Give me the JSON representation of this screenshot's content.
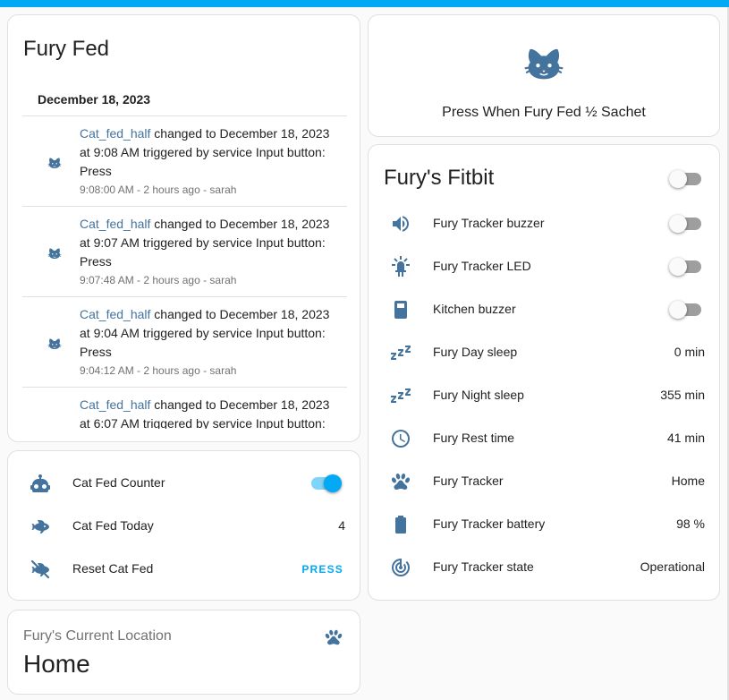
{
  "colors": {
    "accent": "#03a9f4",
    "icon": "#44739e",
    "secondary_text": "#727272"
  },
  "logbook": {
    "title": "Fury Fed",
    "date": "December 18, 2023",
    "entries": [
      {
        "entity": "Cat_fed_half",
        "text": " changed to December 18, 2023 at 9:08 AM triggered by service Input button: Press",
        "meta": "9:08:00 AM - 2 hours ago - sarah",
        "icon": "cat-icon"
      },
      {
        "entity": "Cat_fed_half",
        "text": " changed to December 18, 2023 at 9:07 AM triggered by service Input button: Press",
        "meta": "9:07:48 AM - 2 hours ago - sarah",
        "icon": "cat-icon"
      },
      {
        "entity": "Cat_fed_half",
        "text": " changed to December 18, 2023 at 9:04 AM triggered by service Input button: Press",
        "meta": "9:04:12 AM - 2 hours ago - sarah",
        "icon": "cat-icon"
      },
      {
        "entity": "Cat_fed_half",
        "text": " changed to December 18, 2023 at 6:07 AM triggered by service Input button:",
        "meta": "",
        "icon": "cat-icon"
      }
    ]
  },
  "button_card": {
    "label": "Press When Fury Fed ½ Sachet",
    "icon": "cat-icon"
  },
  "fitbit": {
    "title": "Fury's Fitbit",
    "header_toggle_on": false,
    "rows": [
      {
        "name": "Fury Tracker buzzer",
        "icon": "volume-icon",
        "toggle": false
      },
      {
        "name": "Fury Tracker LED",
        "icon": "led-icon",
        "toggle": false
      },
      {
        "name": "Kitchen buzzer",
        "icon": "remote-icon",
        "toggle": false
      },
      {
        "name": "Fury Day sleep",
        "icon": "sleep-icon",
        "value": "0 min"
      },
      {
        "name": "Fury Night sleep",
        "icon": "sleep-icon",
        "value": "355 min"
      },
      {
        "name": "Fury Rest time",
        "icon": "clock-icon",
        "value": "41 min"
      },
      {
        "name": "Fury Tracker",
        "icon": "paw-icon",
        "value": "Home"
      },
      {
        "name": "Fury Tracker battery",
        "icon": "battery-icon",
        "value": "98 %"
      },
      {
        "name": "Fury Tracker state",
        "icon": "radar-icon",
        "value": "Operational"
      }
    ]
  },
  "entities": {
    "rows": [
      {
        "name": "Cat Fed Counter",
        "icon": "robot-icon",
        "toggle": true
      },
      {
        "name": "Cat Fed Today",
        "icon": "fish-icon",
        "value": "4"
      },
      {
        "name": "Reset Cat Fed",
        "icon": "fish-off-icon",
        "action": "PRESS"
      }
    ]
  },
  "location": {
    "name": "Fury's Current Location",
    "state": "Home",
    "icon": "paw-icon"
  }
}
